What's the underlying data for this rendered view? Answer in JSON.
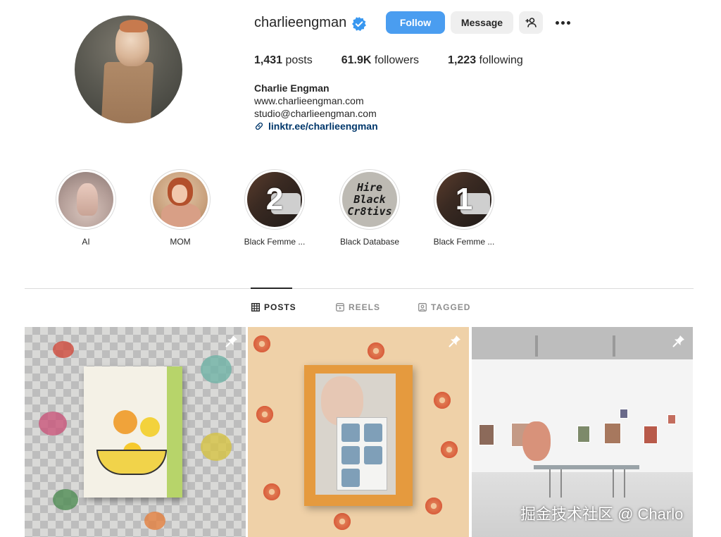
{
  "profile": {
    "username": "charlieengman",
    "verified": true,
    "follow_label": "Follow",
    "message_label": "Message",
    "stats": {
      "posts_count": "1,431",
      "posts_label": "posts",
      "followers_count": "61.9K",
      "followers_label": "followers",
      "following_count": "1,223",
      "following_label": "following"
    },
    "full_name": "Charlie Engman",
    "bio_line1": "www.charlieengman.com",
    "bio_line2": "studio@charlieengman.com",
    "link": "linktr.ee/charlieengman"
  },
  "highlights": [
    {
      "label": "AI"
    },
    {
      "label": "MOM"
    },
    {
      "label": "Black Femme ...",
      "badge": "2"
    },
    {
      "label": "Black Database",
      "cover_text": [
        "Hire",
        "Black",
        "Cr8tivs"
      ]
    },
    {
      "label": "Black Femme ...",
      "badge": "1"
    }
  ],
  "tabs": [
    {
      "label": "POSTS",
      "active": true,
      "icon": "grid-icon"
    },
    {
      "label": "REELS",
      "active": false,
      "icon": "reels-icon"
    },
    {
      "label": "TAGGED",
      "active": false,
      "icon": "tagged-icon"
    }
  ],
  "posts": [
    {
      "pinned": true
    },
    {
      "pinned": true
    },
    {
      "pinned": true
    }
  ],
  "watermark": "掘金技术社区 @ Charlo",
  "colors": {
    "accent": "#4a9df0",
    "link": "#00376b",
    "verified": "#3897f0"
  }
}
